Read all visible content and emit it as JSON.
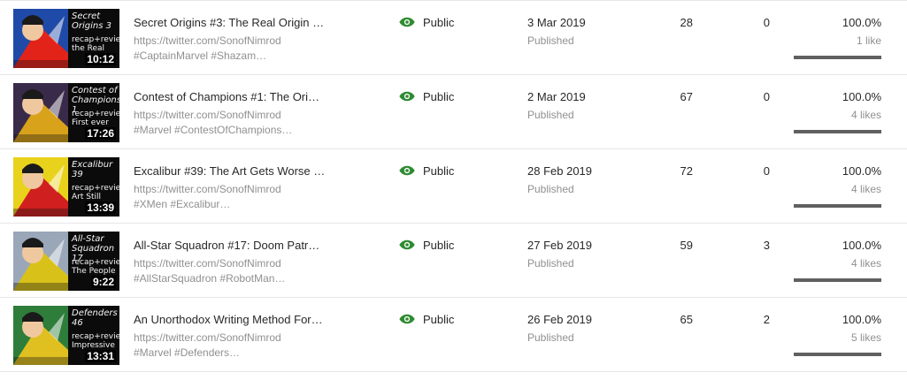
{
  "videos": [
    {
      "thumb": {
        "line1": "Secret Origins 3",
        "line2": "recap+review",
        "line3": "the Real",
        "duration": "10:12",
        "art_bg": "#1f4aa8",
        "art_accent": "#e2231a"
      },
      "title": "Secret Origins #3: The Real Origin …",
      "desc1": "https://twitter.com/SonofNimrod",
      "desc2": "#CaptainMarvel #Shazam…",
      "visibility": "Public",
      "date": "3 Mar 2019",
      "status": "Published",
      "views": "28",
      "comments": "0",
      "like_pct": "100.0%",
      "like_fraction": 1.0,
      "likes": "1 like"
    },
    {
      "thumb": {
        "line1": "Contest of Champions 1",
        "line2": "recap+review",
        "line3": "First ever",
        "duration": "17:26",
        "art_bg": "#3a2a4a",
        "art_accent": "#d8a21a"
      },
      "title": "Contest of Champions #1: The Ori…",
      "desc1": "https://twitter.com/SonofNimrod",
      "desc2": "#Marvel #ContestOfChampions…",
      "visibility": "Public",
      "date": "2 Mar 2019",
      "status": "Published",
      "views": "67",
      "comments": "0",
      "like_pct": "100.0%",
      "like_fraction": 1.0,
      "likes": "4 likes"
    },
    {
      "thumb": {
        "line1": "Excalibur 39",
        "line2": "recap+review",
        "line3": "Art Still",
        "duration": "13:39",
        "art_bg": "#e8d21c",
        "art_accent": "#d01f1f"
      },
      "title": "Excalibur #39: The Art Gets Worse …",
      "desc1": "https://twitter.com/SonofNimrod",
      "desc2": "#XMen #Excalibur…",
      "visibility": "Public",
      "date": "28 Feb 2019",
      "status": "Published",
      "views": "72",
      "comments": "0",
      "like_pct": "100.0%",
      "like_fraction": 1.0,
      "likes": "4 likes"
    },
    {
      "thumb": {
        "line1": "All-Star Squadron 17",
        "line2": "recap+review",
        "line3": "The People",
        "duration": "9:22",
        "art_bg": "#9aa7b8",
        "art_accent": "#d8c21a"
      },
      "title": "All-Star Squadron #17: Doom Patr…",
      "desc1": "https://twitter.com/SonofNimrod",
      "desc2": "#AllStarSquadron #RobotMan…",
      "visibility": "Public",
      "date": "27 Feb 2019",
      "status": "Published",
      "views": "59",
      "comments": "3",
      "like_pct": "100.0%",
      "like_fraction": 1.0,
      "likes": "4 likes"
    },
    {
      "thumb": {
        "line1": "Defenders 46",
        "line2": "recap+review",
        "line3": "Impressive",
        "duration": "13:31",
        "art_bg": "#2e7d3a",
        "art_accent": "#e0c020"
      },
      "title": "An Unorthodox Writing Method For…",
      "desc1": "https://twitter.com/SonofNimrod",
      "desc2": "#Marvel #Defenders…",
      "visibility": "Public",
      "date": "26 Feb 2019",
      "status": "Published",
      "views": "65",
      "comments": "2",
      "like_pct": "100.0%",
      "like_fraction": 1.0,
      "likes": "5 likes"
    }
  ],
  "icons": {
    "visibility": "eye-icon"
  },
  "colors": {
    "public_icon": "#2e8b30",
    "bar_fill": "#606060",
    "bar_track": "#e0e0e0"
  }
}
